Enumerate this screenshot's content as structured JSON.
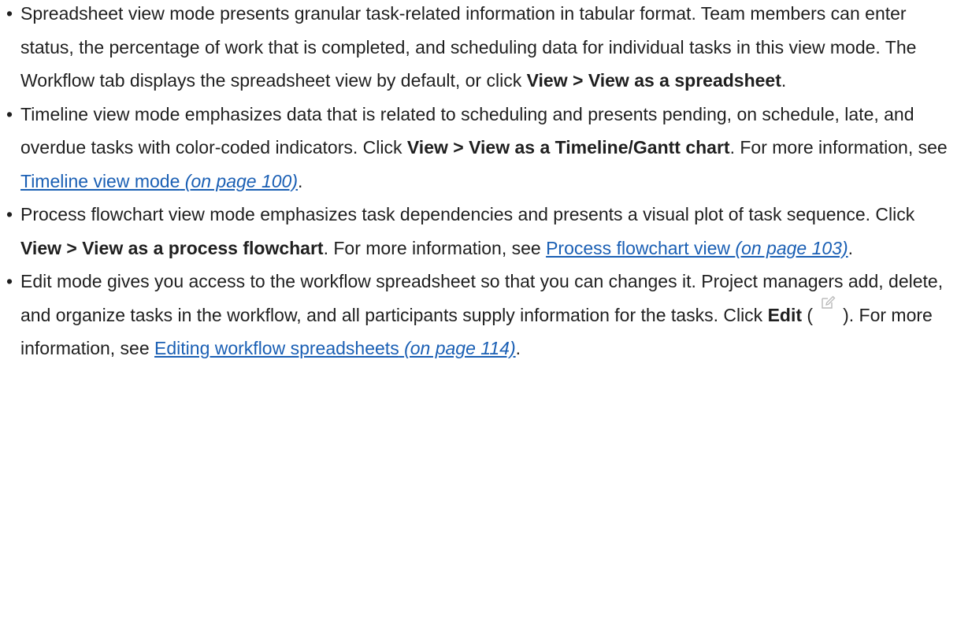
{
  "bullets": [
    {
      "lead": "Spreadsheet view mode presents granular task-related information in tabular format. Team members can enter status, the percentage of work that is completed, and scheduling data for individual tasks in this view mode. The Workflow tab displays the spreadsheet view by default, or click ",
      "bold": "View > View as a spreadsheet",
      "tail": "."
    },
    {
      "lead": "Timeline view mode emphasizes data that is related to scheduling and presents pending, on schedule, late, and overdue tasks with color-coded indicators. Click ",
      "bold": "View > View as a Timeline/Gantt chart",
      "mid": ". For more information, see ",
      "link_text": "Timeline view mode",
      "link_page": "(on page 100)",
      "tail": "."
    },
    {
      "lead": "Process flowchart view mode emphasizes task dependencies and presents a visual plot of task sequence. Click ",
      "bold": "View > View as a process flowchart",
      "mid": ". For more information, see ",
      "link_text": "Process flowchart view",
      "link_page": "(on page 103)",
      "tail": "."
    },
    {
      "lead": "Edit mode gives you access to the workflow spreadsheet so that you can changes it. Project managers add, delete, and organize tasks in the workflow, and all participants supply information for the tasks. Click ",
      "bold": "Edit",
      "open_paren": " (",
      "icon": "edit-icon",
      "close_paren": ")",
      "mid": ". For more information, see ",
      "link_text": "Editing workflow spreadsheets",
      "link_page": "(on page 114)",
      "tail": "."
    }
  ],
  "bullet_glyph": "•",
  "colors": {
    "text": "#1f1f1f",
    "link": "#1a5fb4"
  }
}
